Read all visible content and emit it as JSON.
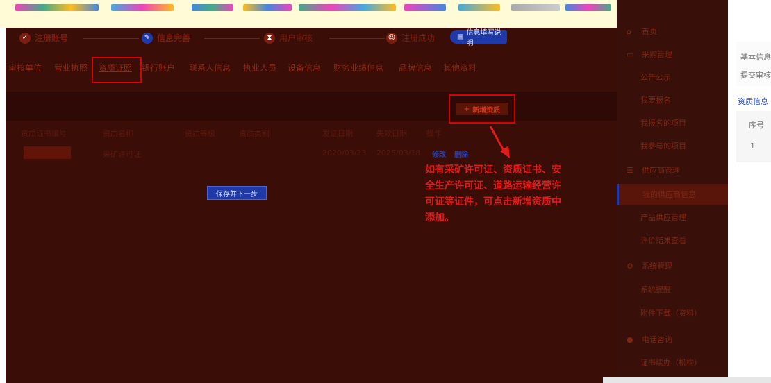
{
  "colors": {
    "accent_blue": "#1f3aa8",
    "annotation_red": "#e11a1a",
    "box_red": "#d50000",
    "bg_main": "#3a0d07"
  },
  "steps": [
    {
      "label": "注册账号",
      "icon": "check-circle-icon"
    },
    {
      "label": "信息完善",
      "icon": "edit-circle-icon"
    },
    {
      "label": "用户审核",
      "icon": "hourglass-icon"
    },
    {
      "label": "注册成功",
      "icon": "smile-icon"
    }
  ],
  "info_button": {
    "label": "信息填写说明"
  },
  "tabs": [
    {
      "label": "审核单位"
    },
    {
      "label": "营业执照"
    },
    {
      "label": "资质证照"
    },
    {
      "label": "银行账户"
    },
    {
      "label": "联系人信息"
    },
    {
      "label": "执业人员"
    },
    {
      "label": "设备信息"
    },
    {
      "label": "财务业绩信息"
    },
    {
      "label": "品牌信息"
    },
    {
      "label": "其他资料"
    }
  ],
  "toolbar": {
    "add_label": "新增资质"
  },
  "table": {
    "headers": [
      "资质证书编号",
      "资质名称",
      "资质等级",
      "资质类别",
      "发证日期",
      "失效日期",
      "操作"
    ],
    "rows": [
      {
        "name": "采矿许可证",
        "issue_date": "2020/03/23",
        "expire_date": "2025/03/18",
        "actions": [
          "修改",
          "删除"
        ]
      }
    ]
  },
  "save_button": {
    "label": "保存并下一步"
  },
  "annotation": {
    "text": "如有采矿许可证、资质证书、安全生产许可证、道路运输经营许可证等证件，可点击新增资质中添加。"
  },
  "sidebar": {
    "items": [
      {
        "label": "首页",
        "icon": "home-icon",
        "type": "header"
      },
      {
        "label": "采购管理",
        "icon": "folder-icon",
        "type": "header"
      },
      {
        "label": "公告公示",
        "type": "sub"
      },
      {
        "label": "我要报名",
        "type": "sub"
      },
      {
        "label": "我报名的项目",
        "type": "sub"
      },
      {
        "label": "我参与的项目",
        "type": "sub"
      },
      {
        "label": "供应商管理",
        "icon": "list-icon",
        "type": "header"
      },
      {
        "label": "我的供应商信息",
        "type": "sub",
        "active": true
      },
      {
        "label": "产品供应管理",
        "type": "sub"
      },
      {
        "label": "评价结果查看",
        "type": "sub"
      },
      {
        "label": "系统管理",
        "icon": "gear-icon",
        "type": "header"
      },
      {
        "label": "系统提醒",
        "type": "sub"
      },
      {
        "label": "附件下载（资料）",
        "type": "sub"
      },
      {
        "label": "电话咨询",
        "icon": "phone-icon",
        "type": "header"
      },
      {
        "label": "证书续办（机构）",
        "type": "sub"
      }
    ]
  },
  "right_panel": {
    "line1": "基本信息",
    "line2": "提交审核",
    "section": "资质信息",
    "col": "序号",
    "row_index": "1"
  }
}
